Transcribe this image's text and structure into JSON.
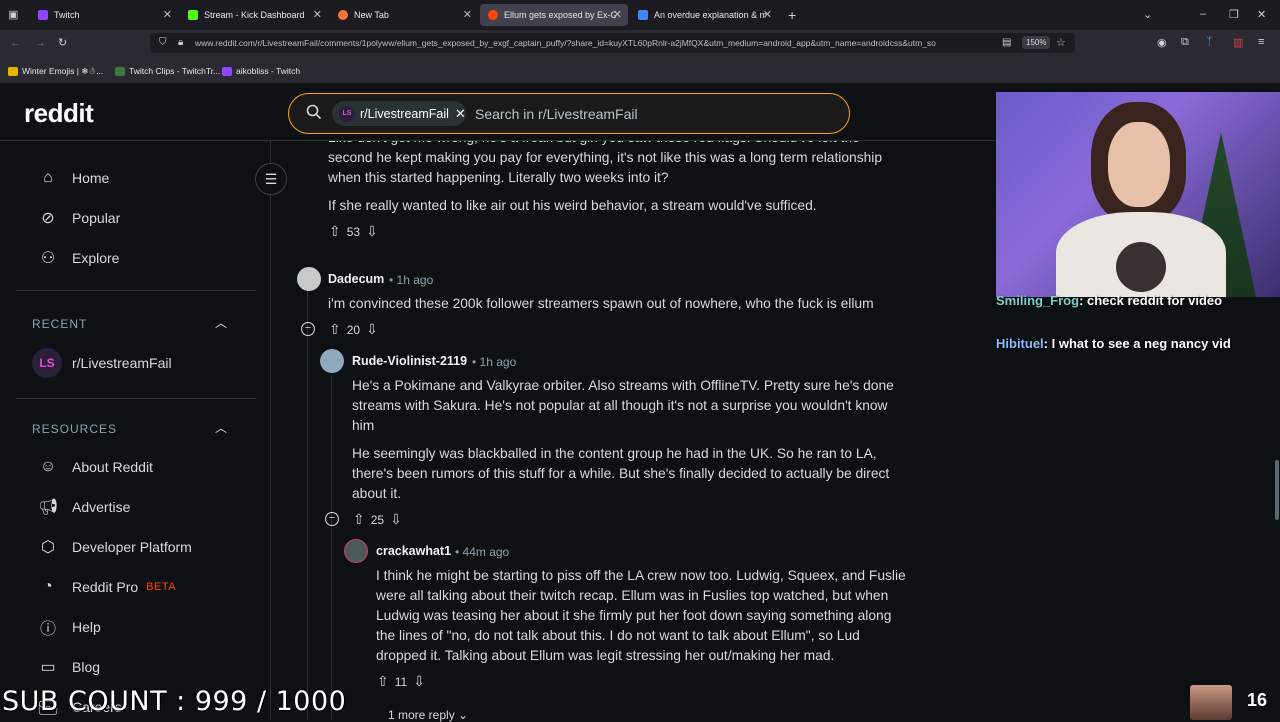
{
  "browser": {
    "tabs": [
      {
        "label": "Twitch",
        "color": "#9146ff"
      },
      {
        "label": "Stream - Kick Dashboard",
        "color": "#53fc18"
      },
      {
        "label": "New Tab",
        "color": "#ff7139"
      },
      {
        "label": "Ellum gets exposed by Ex-GF C...",
        "color": "#ff4500"
      },
      {
        "label": "An overdue explanation & mo...",
        "color": "#4285f4"
      }
    ],
    "new_tab": "+",
    "url": "www.reddit.com/r/LivestreamFail/comments/1polyww/ellum_gets_exposed_by_exgf_captain_puffy/?share_id=kuyXTL60pRnlr-a2jMfQX&utm_medium=android_app&utm_name=androidcss&utm_so",
    "zoom": "150%",
    "bookmarks": [
      "Winter Emojis | ❄☃...",
      "Twitch Clips - TwitchTr...",
      "aikobliss - Twitch"
    ]
  },
  "reddit": {
    "logo": "reddit",
    "search": {
      "chip": "r/LivestreamFail",
      "chip_icon": "LS",
      "placeholder": "Search in r/LivestreamFail"
    }
  },
  "sidebar": {
    "nav": [
      {
        "label": "Home",
        "icon": "home-icon"
      },
      {
        "label": "Popular",
        "icon": "popular-icon"
      },
      {
        "label": "Explore",
        "icon": "explore-icon"
      }
    ],
    "recent_title": "RECENT",
    "recent": [
      {
        "label": "r/LivestreamFail",
        "icon": "LS"
      }
    ],
    "resources_title": "RESOURCES",
    "resources": [
      {
        "label": "About Reddit",
        "icon": "about-icon"
      },
      {
        "label": "Advertise",
        "icon": "advertise-icon"
      },
      {
        "label": "Developer Platform",
        "icon": "developer-icon"
      },
      {
        "label": "Reddit Pro",
        "icon": "pro-icon",
        "badge": "BETA"
      },
      {
        "label": "Help",
        "icon": "help-icon"
      },
      {
        "label": "Blog",
        "icon": "blog-icon"
      },
      {
        "label": "Careers",
        "icon": "careers-icon"
      }
    ]
  },
  "comments": {
    "top_partial": {
      "line1": "Like don't get me wrong, he's a freak but girl you saw these red flags. Should've left the",
      "line2": "second he kept making you pay for everything, it's not like this was a long term relationship",
      "line3": "when this started happening. Literally two weeks into it?",
      "para2": "If she really wanted to like air out his weird behavior, a stream would've sufficed.",
      "votes": "53"
    },
    "c1": {
      "author": "Dadecum",
      "time": "• 1h ago",
      "text": "i'm convinced these 200k follower streamers spawn out of nowhere, who the fuck is ellum",
      "votes": "20"
    },
    "c2": {
      "author": "Rude-Violinist-2119",
      "time": "• 1h ago",
      "p1": "He's a Pokimane and Valkyrae orbiter. Also streams with OfflineTV. Pretty sure he's done streams with Sakura. He's not popular at all though it's not a surprise you wouldn't know him",
      "p2": "He seemingly was blackballed in the content group he had in the UK. So he ran to LA, there's been rumors of this stuff for a while. But she's finally decided to actually be direct about it.",
      "votes": "25"
    },
    "c3": {
      "author": "crackawhat1",
      "time": "• 44m ago",
      "text": "I think he might be starting to piss off the LA crew now too. Ludwig, Squeex, and Fuslie were all talking about their twitch recap. Ellum was in Fuslies top watched, but when Ludwig was teasing her about it she firmly put her foot down saying something along the lines of \"no, do not talk about this. I do not want to talk about Ellum\", so Lud dropped it. Talking about Ellum was legit stressing her out/making her mad.",
      "votes": "11"
    },
    "more_replies": "1 more reply"
  },
  "overlay": {
    "chat": [
      {
        "user": "Smiling_Frog",
        "msg": ": check reddit for video",
        "color": "#7fd0c8"
      },
      {
        "user": "Hibituel",
        "msg": ": I what to see a neg nancy vid",
        "color": "#8fb8ff"
      }
    ],
    "sub_count": "SUB COUNT : 999 / 1000",
    "viewers": "16"
  }
}
